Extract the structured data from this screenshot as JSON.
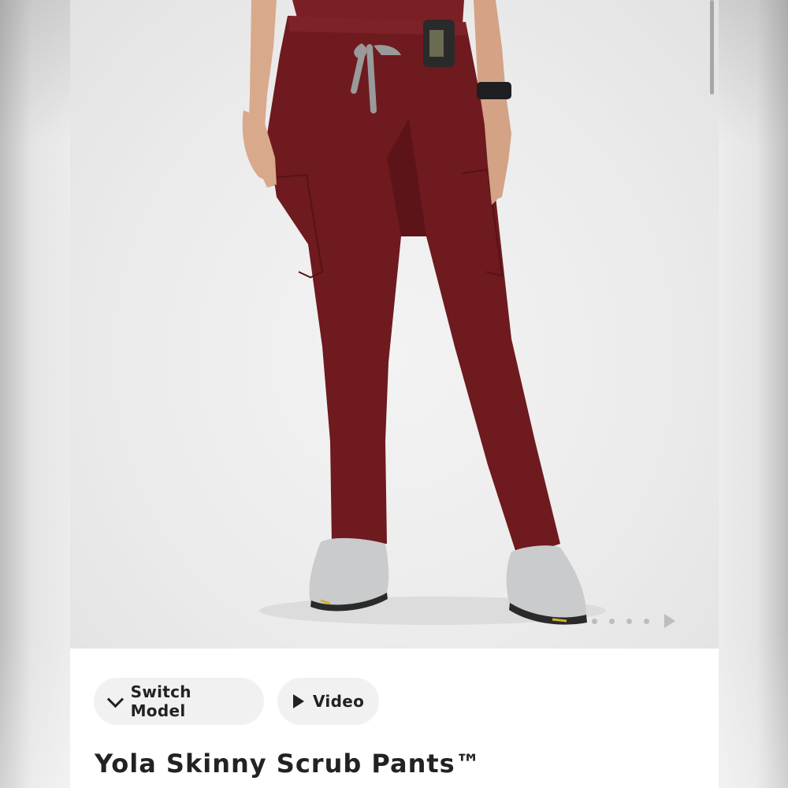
{
  "product": {
    "title": "Yola Skinny Scrub Pants™",
    "image_alt": "Woman wearing burgundy scrub pants and grey sneakers",
    "pants_color": "#6e1a1f"
  },
  "gallery": {
    "dot_count": 4,
    "next_icon": "play-triangle-icon"
  },
  "actions": {
    "switch_model_label": "Switch Model",
    "switch_model_icon": "chevron-down-icon",
    "video_label": "Video",
    "video_icon": "play-icon"
  }
}
